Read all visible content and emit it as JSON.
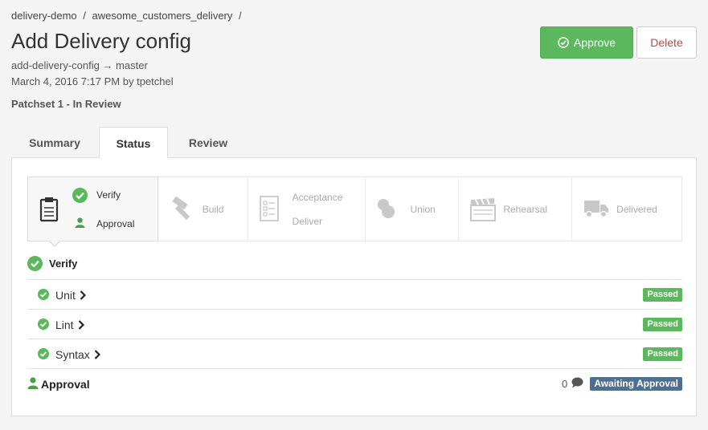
{
  "breadcrumb": {
    "org": "delivery-demo",
    "sep1": "/",
    "project": "awesome_customers_delivery",
    "sep2": "/"
  },
  "page_title": "Add Delivery config",
  "meta": {
    "branch_line": "add-delivery-config → master",
    "date_line": "March 4, 2016 7:17 PM by tpetchel"
  },
  "patchset": "Patchset 1 - In Review",
  "actions": {
    "approve": "Approve",
    "delete": "Delete"
  },
  "tabs": [
    {
      "label": "Summary"
    },
    {
      "label": "Status"
    },
    {
      "label": "Review"
    }
  ],
  "stages": {
    "verify": "Verify",
    "approval": "Approval",
    "build": "Build",
    "acceptance": "Acceptance",
    "deliver": "Deliver",
    "union": "Union",
    "rehearsal": "Rehearsal",
    "delivered": "Delivered"
  },
  "verify_section": {
    "title": "Verify",
    "rows": [
      {
        "name": "Unit",
        "status": "Passed"
      },
      {
        "name": "Lint",
        "status": "Passed"
      },
      {
        "name": "Syntax",
        "status": "Passed"
      }
    ]
  },
  "approval_section": {
    "title": "Approval",
    "comments": "0",
    "status": "Awaiting Approval"
  },
  "colors": {
    "success": "#5cb85c",
    "info": "#4f6f8f",
    "danger": "#b94a48"
  }
}
